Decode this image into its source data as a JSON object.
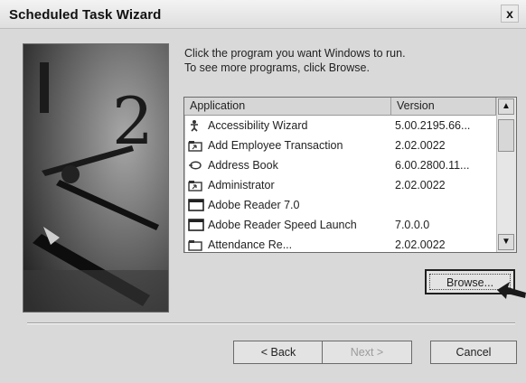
{
  "window": {
    "title": "Scheduled Task Wizard",
    "close_glyph": "x"
  },
  "intro": {
    "line1": "Click the program you want Windows to run.",
    "line2": "To see more programs, click Browse."
  },
  "list": {
    "columns": [
      "Application",
      "Version"
    ],
    "rows": [
      {
        "icon": "accessibility-icon",
        "app": "Accessibility Wizard",
        "version": "5.00.2195.66..."
      },
      {
        "icon": "folder-shortcut-icon",
        "app": "Add Employee Transaction",
        "version": "2.02.0022"
      },
      {
        "icon": "address-book-icon",
        "app": "Address Book",
        "version": "6.00.2800.11..."
      },
      {
        "icon": "folder-shortcut-icon",
        "app": "Administrator",
        "version": "2.02.0022"
      },
      {
        "icon": "app-window-icon",
        "app": "Adobe Reader 7.0",
        "version": ""
      },
      {
        "icon": "app-window-icon",
        "app": "Adobe Reader Speed Launch",
        "version": "7.0.0.0"
      },
      {
        "icon": "folder-shortcut-icon",
        "app": "Attendance Re...",
        "version": "2.02.0022"
      }
    ]
  },
  "buttons": {
    "browse": "Browse...",
    "back": "< Back",
    "next": "Next >",
    "cancel": "Cancel"
  }
}
